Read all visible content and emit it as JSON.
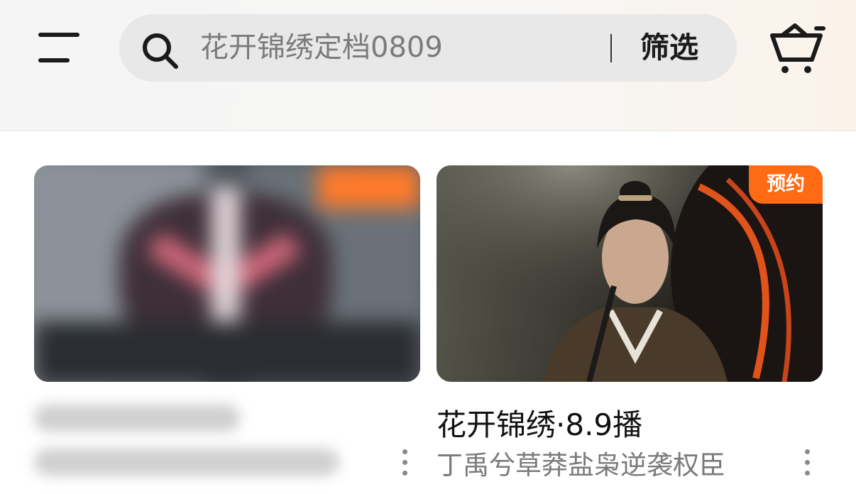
{
  "header": {
    "menu_icon": "hamburger-menu-icon",
    "search": {
      "icon": "search-icon",
      "placeholder": "花开锦绣定档0809",
      "filter_label": "筛选"
    },
    "cart_icon": "shopping-cart-icon"
  },
  "colors": {
    "accent": "#ff6a13",
    "search_bg": "#e8e8e8"
  },
  "cards": [
    {
      "title": "",
      "subtitle": "",
      "badge": "",
      "blurred": true,
      "more_icon": "more-vertical-icon"
    },
    {
      "badge": "预约",
      "title": "花开锦绣·8.9播",
      "subtitle": "丁禹兮草莽盐枭逆袭权臣",
      "more_icon": "more-vertical-icon"
    }
  ]
}
